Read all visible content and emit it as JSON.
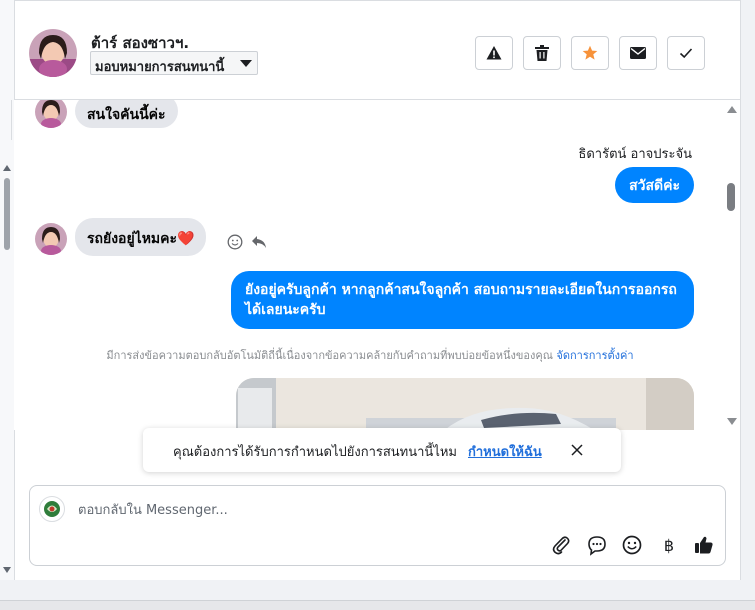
{
  "header": {
    "contact_name": "ต้าร์ สองซาวฯ.",
    "assign_label": "มอบหมายการสนทนานี้",
    "actions": [
      {
        "name": "report",
        "icon": "warning-triangle-icon"
      },
      {
        "name": "delete",
        "icon": "trash-icon"
      },
      {
        "name": "star",
        "icon": "star-icon"
      },
      {
        "name": "mark-unread",
        "icon": "envelope-icon"
      },
      {
        "name": "mark-done",
        "icon": "check-icon"
      }
    ]
  },
  "messages": [
    {
      "direction": "in",
      "text": "สนใจคันนี้ค่ะ"
    },
    {
      "direction": "out",
      "sender": "ธิดารัตน์ อาจประจัน",
      "text": "สวัสดีค่ะ"
    },
    {
      "direction": "in",
      "text": "รถยังอยู่ไหมคะ❤️"
    },
    {
      "direction": "out",
      "text": "ยังอยู่ครับลูกค้า หากลูกค้าสนใจลูกค้า สอบถามรายละเอียดในการออกรถได้เลยนะครับ"
    }
  ],
  "auto_reply_note": {
    "text": "มีการส่งข้อความตอบกลับอัตโนมัติถี่นี้เนื่องจากข้อความคล้ายกับคำถามที่พบบ่อยข้อหนึ่งของคุณ",
    "link": "จัดการการตั้งค่า"
  },
  "toast": {
    "text": "คุณต้องการได้รับการกำหนดไปยังการสนทนานี้ไหม",
    "link": "กำหนดให้ฉัน"
  },
  "composer": {
    "placeholder": "ตอบกลับใน Messenger...",
    "icons": [
      "paperclip-icon",
      "saved-reply-icon",
      "emoji-icon",
      "baht-icon",
      "thumbs-up-icon"
    ]
  },
  "colors": {
    "accent": "#0084ff",
    "star": "#f7923a",
    "link": "#216fdb"
  }
}
